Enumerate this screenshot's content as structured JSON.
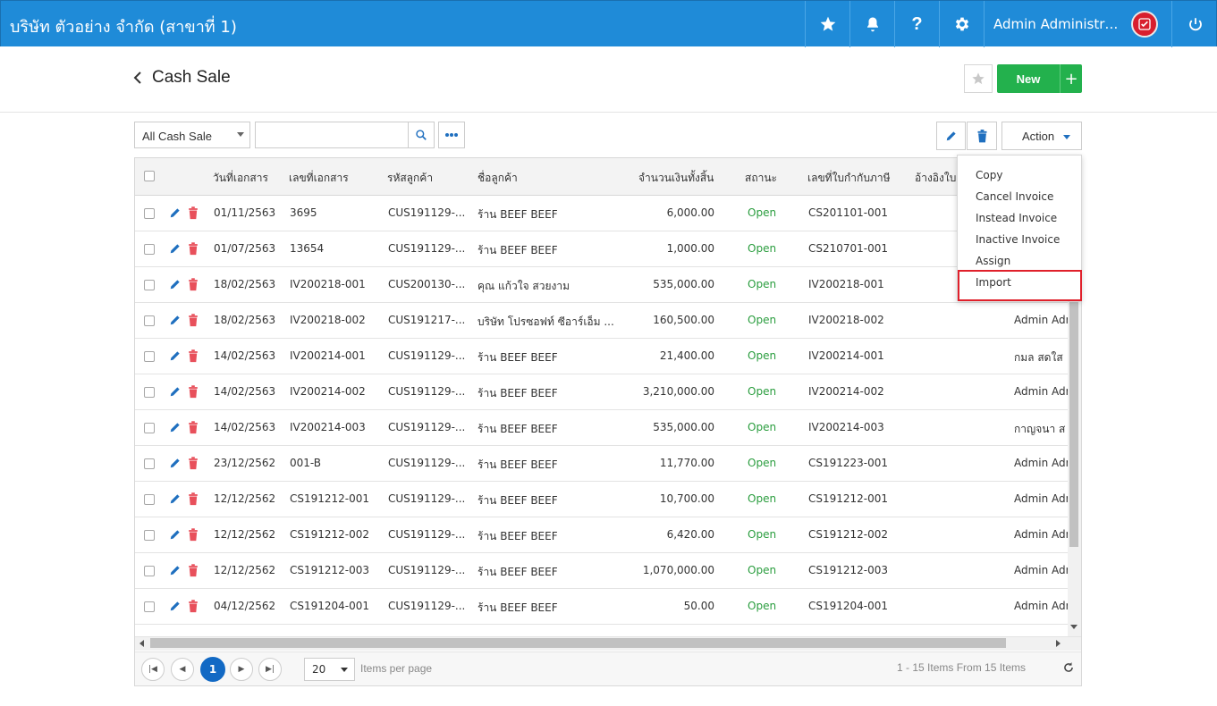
{
  "topbar": {
    "company": "บริษัท ตัวอย่าง จำกัด (สาขาที่ 1)",
    "user_name": "Admin Administrator",
    "icons": [
      "star-icon",
      "bell-icon",
      "help-icon",
      "gear-icon",
      "power-icon"
    ]
  },
  "page": {
    "title": "Cash Sale",
    "new_label": "New",
    "plus_label": "+"
  },
  "toolbar": {
    "filter_value": "All Cash Sale",
    "search_value": "",
    "action_label": "Action"
  },
  "action_menu": {
    "items": [
      "Copy",
      "Cancel Invoice",
      "Instead Invoice",
      "Inactive Invoice",
      "Assign",
      "Import"
    ],
    "highlighted": "Import",
    "highlight_color": "#e0202b"
  },
  "table": {
    "columns": {
      "date": "วันที่เอกสาร",
      "doc_no": "เลขที่เอกสาร",
      "cust_code": "รหัสลูกค้า",
      "cust_name": "ชื่อลูกค้า",
      "amount": "จำนวนเงินทั้งสิ้น",
      "status": "สถานะ",
      "tax_no": "เลขที่ใบกำกับภาษี",
      "ref": "อ้างอิงใบ"
    },
    "rows": [
      {
        "date": "01/11/2563",
        "doc_no": "3695",
        "cust_code": "CUS191129-...",
        "cust_name": "ร้าน BEEF BEEF",
        "amount": "6,000.00",
        "status": "Open",
        "tax_no": "CS201101-001",
        "owner": ""
      },
      {
        "date": "01/07/2563",
        "doc_no": "13654",
        "cust_code": "CUS191129-...",
        "cust_name": "ร้าน BEEF BEEF",
        "amount": "1,000.00",
        "status": "Open",
        "tax_no": "CS210701-001",
        "owner": ""
      },
      {
        "date": "18/02/2563",
        "doc_no": "IV200218-001",
        "cust_code": "CUS200130-...",
        "cust_name": "คุณ แก้วใจ สวยงาม",
        "amount": "535,000.00",
        "status": "Open",
        "tax_no": "IV200218-001",
        "owner": ""
      },
      {
        "date": "18/02/2563",
        "doc_no": "IV200218-002",
        "cust_code": "CUS191217-...",
        "cust_name": "บริษัท โปรซอฟท์ ซีอาร์เอ็ม ...",
        "amount": "160,500.00",
        "status": "Open",
        "tax_no": "IV200218-002",
        "owner": "Admin Adm"
      },
      {
        "date": "14/02/2563",
        "doc_no": "IV200214-001",
        "cust_code": "CUS191129-...",
        "cust_name": "ร้าน BEEF BEEF",
        "amount": "21,400.00",
        "status": "Open",
        "tax_no": "IV200214-001",
        "owner": "กมล สดใส"
      },
      {
        "date": "14/02/2563",
        "doc_no": "IV200214-002",
        "cust_code": "CUS191129-...",
        "cust_name": "ร้าน BEEF BEEF",
        "amount": "3,210,000.00",
        "status": "Open",
        "tax_no": "IV200214-002",
        "owner": "Admin Adm"
      },
      {
        "date": "14/02/2563",
        "doc_no": "IV200214-003",
        "cust_code": "CUS191129-...",
        "cust_name": "ร้าน BEEF BEEF",
        "amount": "535,000.00",
        "status": "Open",
        "tax_no": "IV200214-003",
        "owner": "กาญจนา ส"
      },
      {
        "date": "23/12/2562",
        "doc_no": "001-B",
        "cust_code": "CUS191129-...",
        "cust_name": "ร้าน BEEF BEEF",
        "amount": "11,770.00",
        "status": "Open",
        "tax_no": "CS191223-001",
        "owner": "Admin Adm"
      },
      {
        "date": "12/12/2562",
        "doc_no": "CS191212-001",
        "cust_code": "CUS191129-...",
        "cust_name": "ร้าน BEEF BEEF",
        "amount": "10,700.00",
        "status": "Open",
        "tax_no": "CS191212-001",
        "owner": "Admin Adm"
      },
      {
        "date": "12/12/2562",
        "doc_no": "CS191212-002",
        "cust_code": "CUS191129-...",
        "cust_name": "ร้าน BEEF BEEF",
        "amount": "6,420.00",
        "status": "Open",
        "tax_no": "CS191212-002",
        "owner": "Admin Adm"
      },
      {
        "date": "12/12/2562",
        "doc_no": "CS191212-003",
        "cust_code": "CUS191129-...",
        "cust_name": "ร้าน BEEF BEEF",
        "amount": "1,070,000.00",
        "status": "Open",
        "tax_no": "CS191212-003",
        "owner": "Admin Adm"
      },
      {
        "date": "04/12/2562",
        "doc_no": "CS191204-001",
        "cust_code": "CUS191129-...",
        "cust_name": "ร้าน BEEF BEEF",
        "amount": "50.00",
        "status": "Open",
        "tax_no": "CS191204-001",
        "owner": "Admin Adm"
      }
    ]
  },
  "pager": {
    "current_page": "1",
    "page_size": "20",
    "items_per_page": "Items per page",
    "count_text": "1 - 15 Items From 15 Items"
  },
  "colors": {
    "topbar": "#1f8bd8",
    "new_button": "#23b14d",
    "status_open": "#2a9d3e",
    "delete_icon": "#e8505b",
    "edit_icon": "#1f6fbf"
  }
}
